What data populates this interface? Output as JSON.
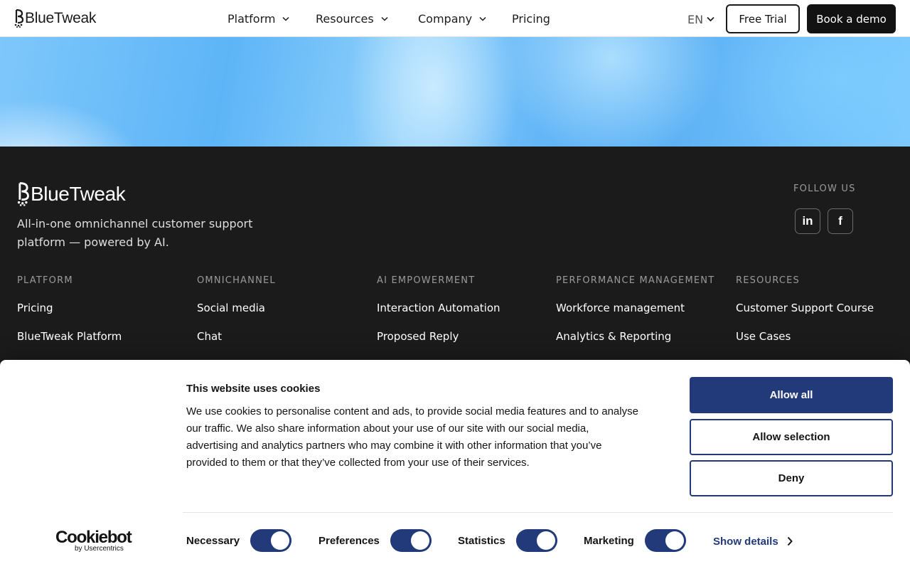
{
  "header": {
    "brand": "BlueTweak",
    "nav": [
      {
        "label": "Platform",
        "has_dropdown": true
      },
      {
        "label": "Resources",
        "has_dropdown": true
      },
      {
        "label": "Company",
        "has_dropdown": true
      },
      {
        "label": "Pricing",
        "has_dropdown": false
      }
    ],
    "language": "EN",
    "free_trial": "Free Trial",
    "book_demo": "Book a demo"
  },
  "footer": {
    "brand": "BlueTweak",
    "tagline": "All-in-one omnichannel customer support platform — powered by AI.",
    "follow_us": "FOLLOW US",
    "social": [
      {
        "label": "in",
        "icon": "linkedin-icon"
      },
      {
        "label": "f",
        "icon": "facebook-icon"
      }
    ],
    "columns": [
      {
        "heading": "PLATFORM",
        "links": [
          "Pricing",
          "BlueTweak Platform"
        ]
      },
      {
        "heading": "OMNICHANNEL",
        "links": [
          "Social media",
          "Chat"
        ]
      },
      {
        "heading": "AI EMPOWERMENT",
        "links": [
          "Interaction Automation",
          "Proposed Reply"
        ]
      },
      {
        "heading": "PERFORMANCE MANAGEMENT",
        "links": [
          "Workforce management",
          "Analytics & Reporting"
        ]
      },
      {
        "heading": "RESOURCES",
        "links": [
          "Customer Support Course",
          "Use Cases"
        ]
      }
    ]
  },
  "cookie_banner": {
    "title": "This website uses cookies",
    "text": "We use cookies to personalise content and ads, to provide social media features and to analyse our traffic. We also share information about your use of our site with our social media, advertising and analytics partners who may combine it with other information that you’ve provided to them or that they’ve collected from your use of their services.",
    "allow_all": "Allow all",
    "allow_selection": "Allow selection",
    "deny": "Deny",
    "provider": "Cookiebot",
    "provider_sub": "by Usercentrics",
    "toggles": [
      {
        "label": "Necessary",
        "on": true
      },
      {
        "label": "Preferences",
        "on": true
      },
      {
        "label": "Statistics",
        "on": true
      },
      {
        "label": "Marketing",
        "on": true
      }
    ],
    "show_details": "Show details",
    "accent_color": "#22397a"
  }
}
